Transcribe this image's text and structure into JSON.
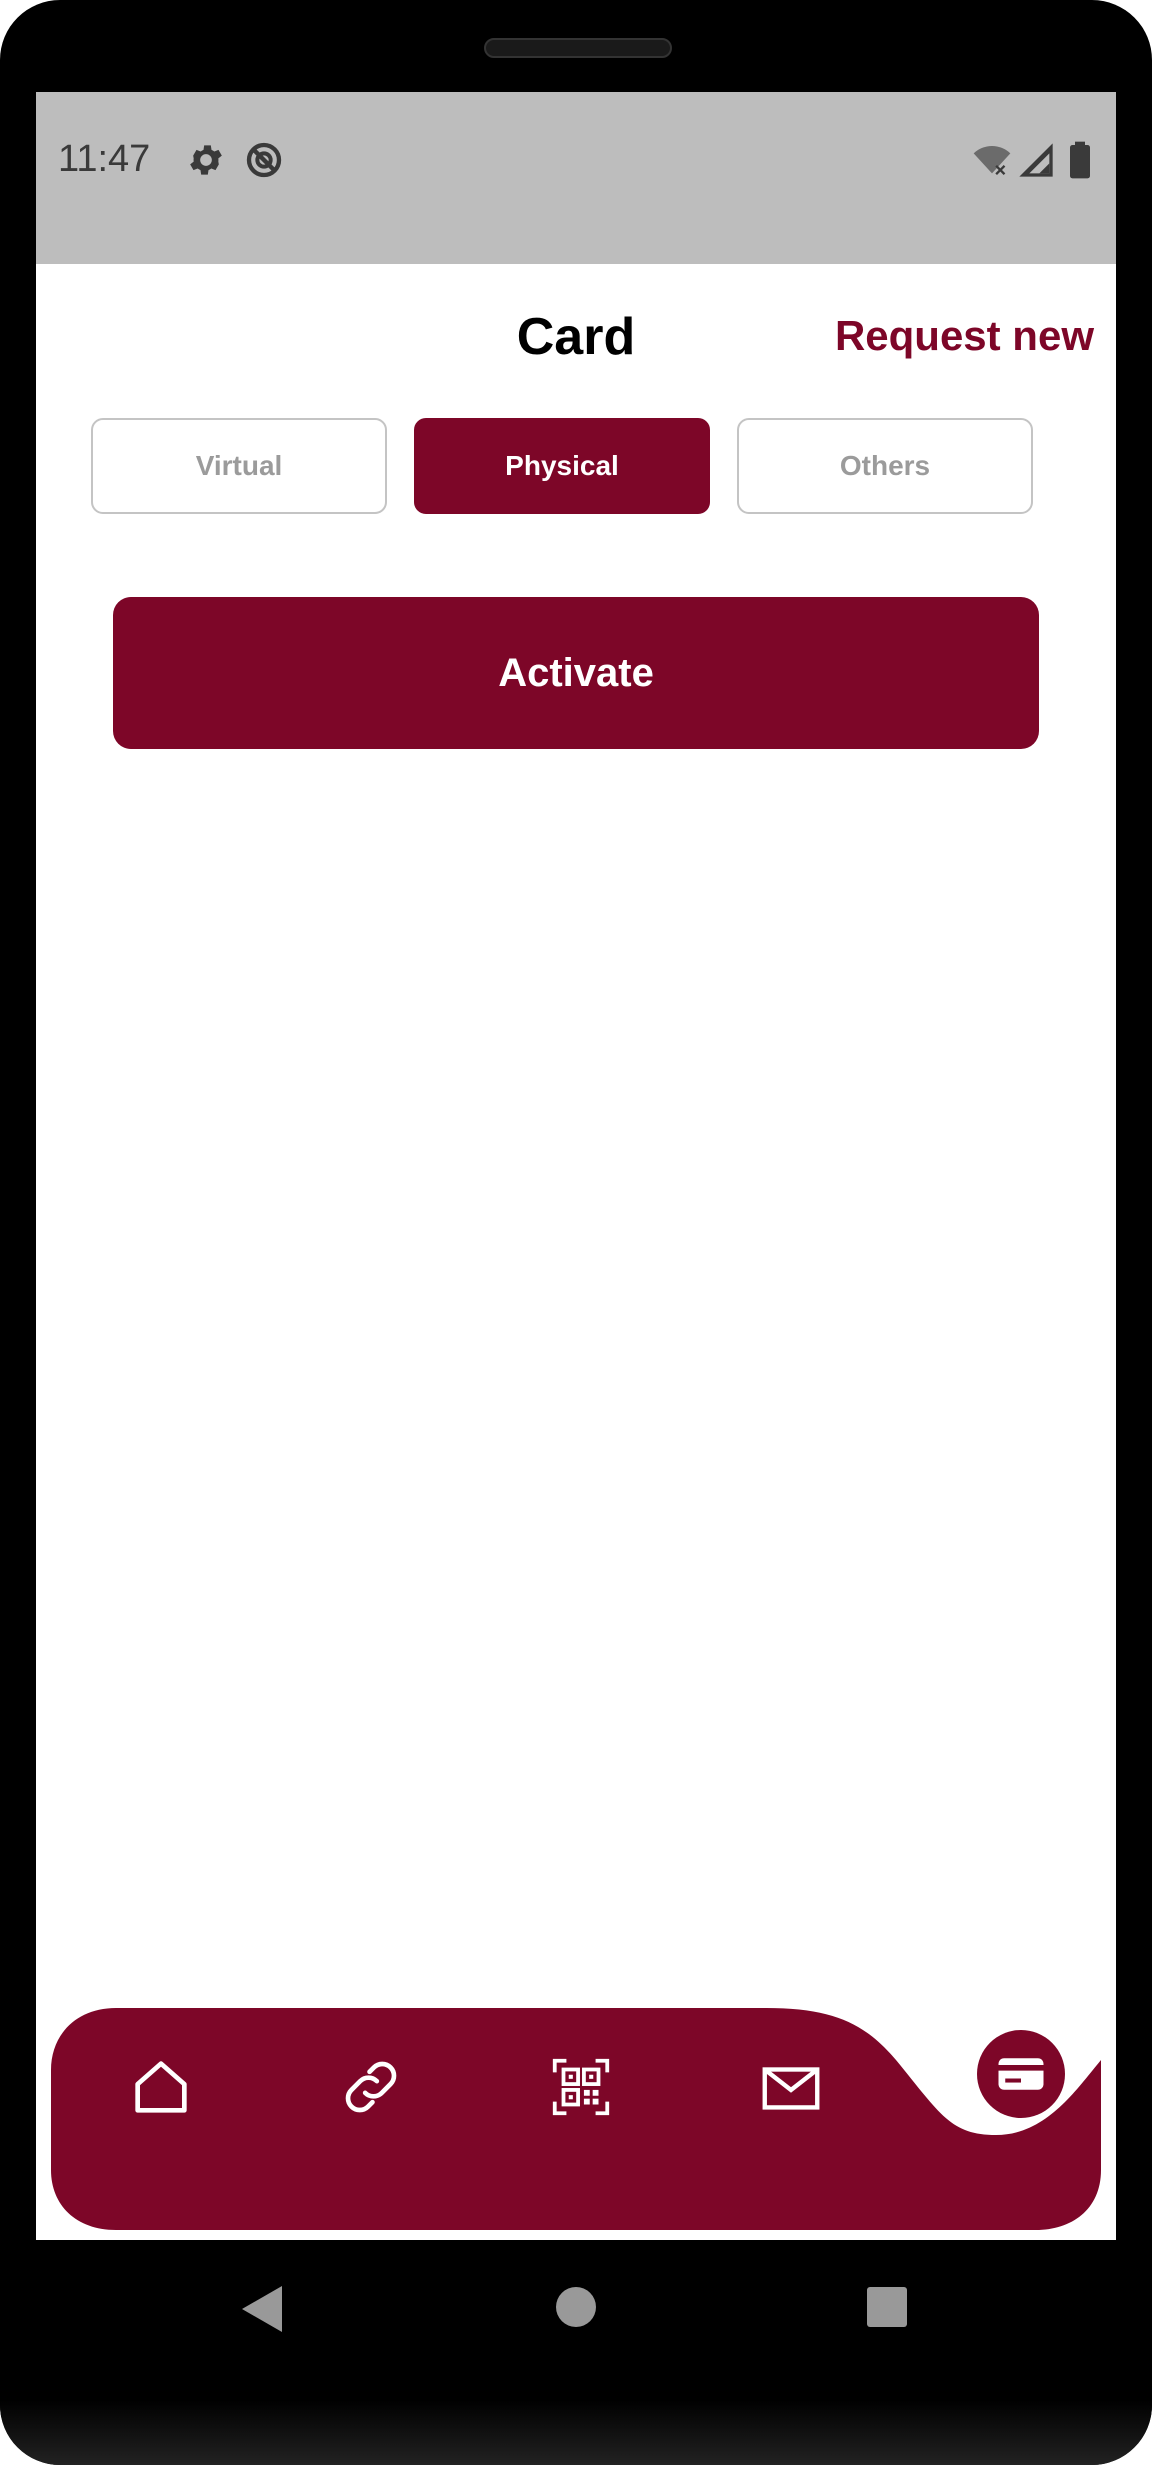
{
  "status_bar": {
    "time": "11:47",
    "icons": [
      "gear-icon",
      "do-not-disturb-icon",
      "wifi-off-icon",
      "signal-icon",
      "battery-icon"
    ]
  },
  "header": {
    "title": "Card",
    "request_new_label": "Request new"
  },
  "tabs": [
    {
      "label": "Virtual",
      "active": false
    },
    {
      "label": "Physical",
      "active": true
    },
    {
      "label": "Others",
      "active": false
    }
  ],
  "activate_label": "Activate",
  "bottom_nav": {
    "items": [
      "home-icon",
      "link-icon",
      "qr-code-icon",
      "mail-icon"
    ],
    "selected": "card-icon"
  },
  "system_nav": [
    "back-icon",
    "home-circle-icon",
    "recents-icon"
  ],
  "colors": {
    "brand": "#7d0628",
    "status_bar": "#bdbdbd",
    "inactive_text": "#9b9b9b"
  }
}
